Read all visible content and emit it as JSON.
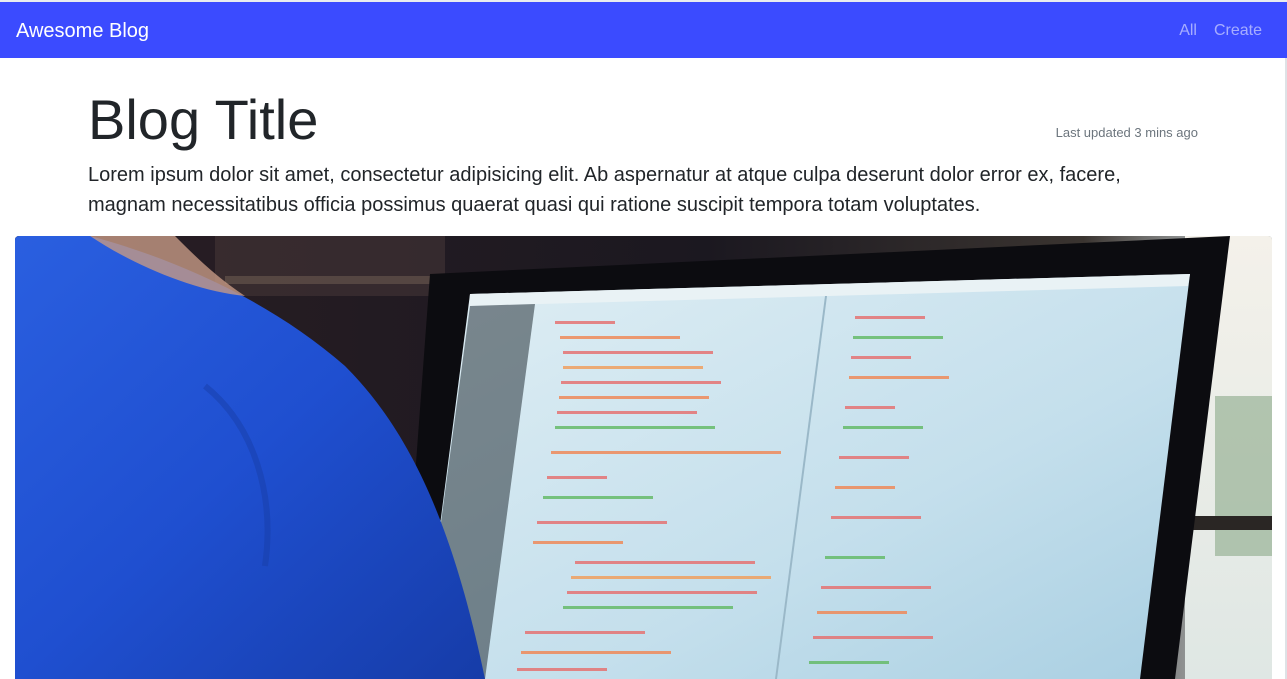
{
  "navbar": {
    "brand": "Awesome Blog",
    "links": [
      {
        "label": "All"
      },
      {
        "label": "Create"
      }
    ],
    "background": "#3b4bff"
  },
  "post": {
    "title": "Blog Title",
    "updated": "Last updated 3 mins ago",
    "lead": "Lorem ipsum dolor sit amet, consectetur adipisicing elit. Ab aspernatur at atque culpa deserunt dolor error ex, facere, magnam necessitatibus officia possimus quaerat quasi qui ratione suscipit tempora totam voluptates."
  },
  "hero_image": {
    "subject": "photo of a person in a blue shirt looking at a monitor with code"
  }
}
